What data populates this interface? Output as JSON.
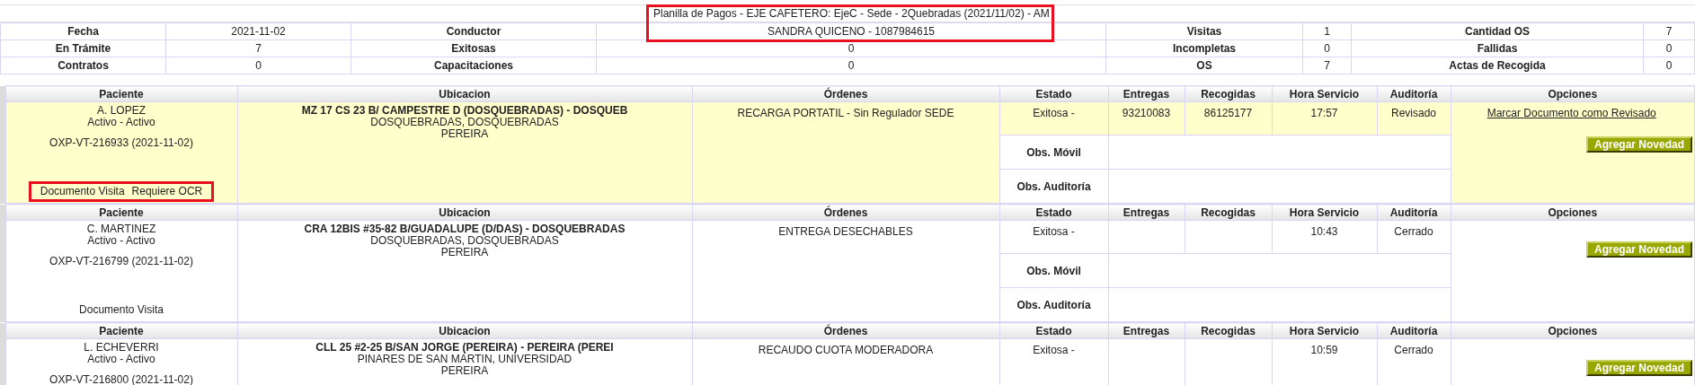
{
  "title": {
    "text": "Planilla de Pagos - EJE CAFETERO: EjeC - Sede - 2Quebradas (2021/11/02) - AM",
    "marked": true
  },
  "summary": [
    [
      {
        "label": "Fecha",
        "value": "2021-11-02"
      },
      {
        "label": "Conductor",
        "value": "SANDRA QUICENO - 1087984615"
      },
      {
        "label": "Visitas",
        "value": "1"
      },
      {
        "label": "Cantidad OS",
        "value": "7"
      }
    ],
    [
      {
        "label": "En Trámite",
        "value": "7"
      },
      {
        "label": "Exitosas",
        "value": "0"
      },
      {
        "label": "Incompletas",
        "value": "0"
      },
      {
        "label": "Fallidas",
        "value": "0"
      }
    ],
    [
      {
        "label": "Contratos",
        "value": "0"
      },
      {
        "label": "Capacitaciones",
        "value": "0"
      },
      {
        "label": "OS",
        "value": "7"
      },
      {
        "label": "Actas de Recogida",
        "value": "0"
      }
    ]
  ],
  "records": [
    {
      "highlighted": true,
      "columns": [
        "Paciente",
        "Ubicacion",
        "Órdenes",
        "Estado",
        "Entregas",
        "Recogidas",
        "Hora Servicio",
        "Auditoría",
        "Opciones"
      ],
      "patient": "A. LOPEZ",
      "status": "Activo - Activo",
      "document": "OXP-VT-216933 (2021-11-02)",
      "doc_links": [
        "Documento Visita",
        "Requiere OCR"
      ],
      "doc_marked": true,
      "address": "MZ 17 CS 23 B/ CAMPESTRE D (DOSQUEBRADAS) - DOSQUEB",
      "area": "DOSQUEBRADAS, DOSQUEBRADAS",
      "city": "PEREIRA",
      "order": "RECARGA PORTATIL - Sin Regulador SEDE",
      "estado": "Exitosa -",
      "entregas": "93210083",
      "recogidas": "86125177",
      "hora": "17:57",
      "auditoria": "Revisado",
      "obs": [
        "Obs. Móvil",
        "Obs. Auditoría"
      ],
      "option_link": "Marcar Documento como Revisado",
      "button": "Agregar Novedad"
    },
    {
      "highlighted": false,
      "columns": [
        "Paciente",
        "Ubicacion",
        "Órdenes",
        "Estado",
        "Entregas",
        "Recogidas",
        "Hora Servicio",
        "Auditoría",
        "Opciones"
      ],
      "patient": "C. MARTINEZ",
      "status": "Activo - Activo",
      "document": "OXP-VT-216799 (2021-11-02)",
      "doc_links": [
        "Documento Visita"
      ],
      "doc_marked": false,
      "address": "CRA 12BIS #35-82 B/GUADALUPE (D/DAS) - DOSQUEBRADAS",
      "area": "DOSQUEBRADAS, DOSQUEBRADAS",
      "city": "PEREIRA",
      "order": "ENTREGA DESECHABLES",
      "estado": "Exitosa -",
      "hora": "10:43",
      "auditoria": "Cerrado",
      "obs": [
        "Obs. Móvil",
        "Obs. Auditoría"
      ],
      "button": "Agregar Novedad"
    },
    {
      "highlighted": false,
      "columns": [
        "Paciente",
        "Ubicacion",
        "Órdenes",
        "Estado",
        "Entregas",
        "Recogidas",
        "Hora Servicio",
        "Auditoría",
        "Opciones"
      ],
      "patient": "L. ECHEVERRI",
      "status": "Activo - Activo",
      "document": "OXP-VT-216800 (2021-11-02)",
      "address": "CLL 25 #2-25 B/SAN JORGE (PEREIRA) - PEREIRA (PEREI",
      "area": "PINARES DE SAN MARTIN, UNIVERSIDAD",
      "city": "PEREIRA",
      "order": "RECAUDO CUOTA MODERADORA",
      "estado": "Exitosa -",
      "hora": "10:59",
      "auditoria": "Cerrado",
      "button": "Agregar Novedad"
    }
  ]
}
